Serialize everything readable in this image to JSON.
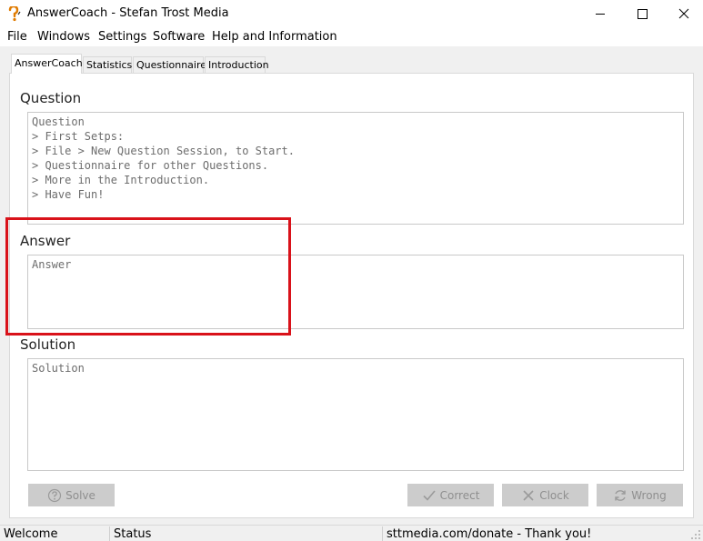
{
  "window": {
    "title": "AnswerCoach - Stefan Trost Media",
    "icon": "app-question-icon"
  },
  "menu": {
    "items": [
      "File",
      "Windows",
      "Settings",
      "Software",
      "Help and Information"
    ]
  },
  "tabs": [
    {
      "label": "AnswerCoach",
      "active": true
    },
    {
      "label": "Statistics",
      "active": false
    },
    {
      "label": "Questionnaire",
      "active": false
    },
    {
      "label": "Introduction",
      "active": false
    }
  ],
  "question": {
    "label": "Question",
    "text": "Question\n> First Setps:\n> File > New Question Session, to Start.\n> Questionnaire for other Questions.\n> More in the Introduction.\n> Have Fun!"
  },
  "answer": {
    "label": "Answer",
    "placeholder": "Answer"
  },
  "solution": {
    "label": "Solution",
    "placeholder": "Solution"
  },
  "buttons": {
    "solve": "Solve",
    "correct": "Correct",
    "clock": "Clock",
    "wrong": "Wrong"
  },
  "status": {
    "welcome": "Welcome",
    "status": "Status",
    "donate": "sttmedia.com/donate - Thank you!"
  },
  "colors": {
    "highlight": "#d9121a",
    "app_icon": "#e07b00"
  }
}
